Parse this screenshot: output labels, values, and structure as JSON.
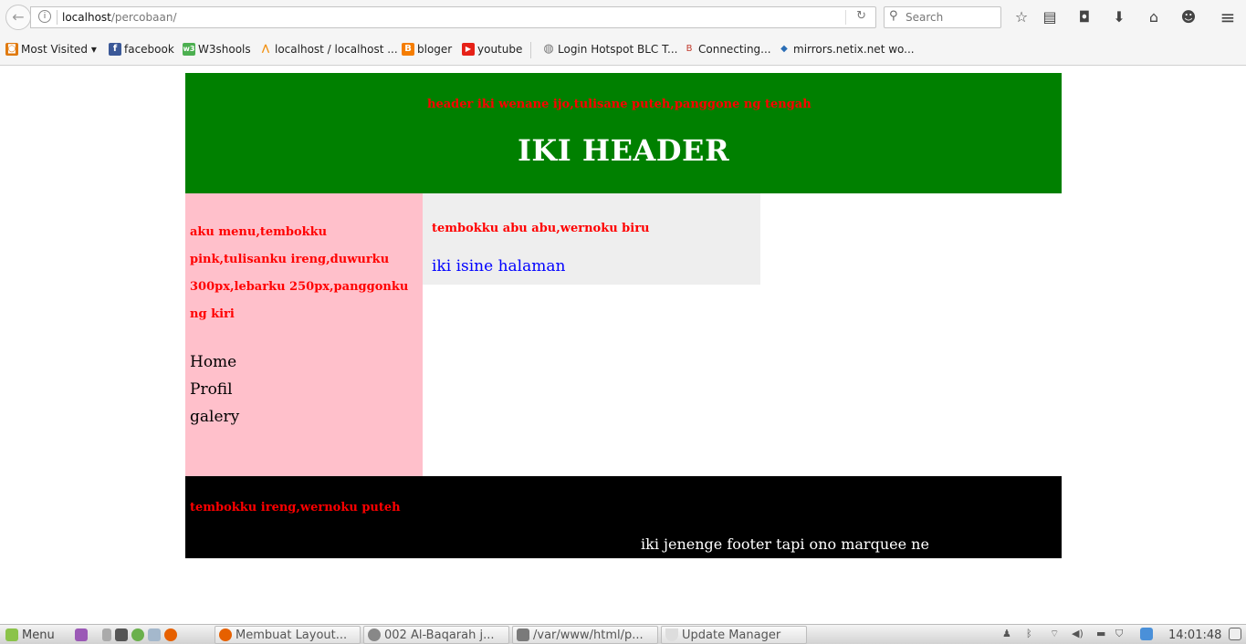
{
  "browser": {
    "url_host": "localhost",
    "url_path": "/percobaan/",
    "search_placeholder": "Search",
    "icons": [
      "back-arrow-icon",
      "info-icon",
      "reload-icon",
      "search-icon",
      "bookmark-star-icon",
      "reading-list-icon",
      "pocket-icon",
      "download-icon",
      "home-icon",
      "chat-icon",
      "hamburger-menu-icon"
    ],
    "glyphs": {
      "back": "←",
      "info": "i",
      "reload": "↻",
      "search": "⚲",
      "star": "☆",
      "reader": "▤",
      "pocket": "◘",
      "download": "⬇",
      "home": "⌂",
      "chat": "☻",
      "menu": "≡"
    }
  },
  "bookmarks": [
    {
      "label": "Most Visited ▾",
      "icon": "most-visited-icon",
      "color": "#e07a10",
      "glyph": "◙"
    },
    {
      "label": "facebook",
      "icon": "facebook-icon",
      "color": "#3b5998",
      "glyph": "f"
    },
    {
      "label": "W3shools",
      "icon": "w3schools-icon",
      "color": "#4caf50",
      "glyph": "w3"
    },
    {
      "label": "localhost / localhost ...",
      "icon": "phpmyadmin-icon",
      "color": "#f29111",
      "glyph": "⋀"
    },
    {
      "label": "bloger",
      "icon": "blogger-icon",
      "color": "#f57d00",
      "glyph": "B"
    },
    {
      "label": "youtube",
      "icon": "youtube-icon",
      "color": "#e62117",
      "glyph": "▶"
    },
    {
      "label": "Login Hotspot BLC T...",
      "icon": "globe-icon",
      "color": "#888888",
      "glyph": "◍"
    },
    {
      "label": "Connecting...",
      "icon": "bir-icon",
      "color": "#c0392b",
      "glyph": "B"
    },
    {
      "label": "mirrors.netix.net wo...",
      "icon": "tag-icon",
      "color": "#2a6db5",
      "glyph": "◆"
    }
  ],
  "page": {
    "header_note": "header iki wenane ijo,tulisane puteh,panggone ng tengah",
    "header_title": "IKI HEADER",
    "menu_note": "aku menu,tembokku pink,tulisanku ireng,duwurku 300px,lebarku 250px,panggonku ng kiri",
    "menu_links": [
      "Home",
      "Profil",
      "galery"
    ],
    "content_note": "tembokku abu abu,wernoku biru",
    "content_text": "iki isine halaman",
    "footer_note": "tembokku ireng,wernoku puteh",
    "footer_marquee": "iki jenenge footer tapi ono marquee ne",
    "colors": {
      "header_bg": "#008000",
      "menu_bg": "#ffc0cb",
      "content_bg": "#eeeeee",
      "footer_bg": "#000000",
      "note_color": "#ff0000",
      "content_text_color": "#0000ff"
    }
  },
  "taskbar": {
    "menu_label": "Menu",
    "tasks": [
      "Membuat Layout...",
      "002 Al-Baqarah j...",
      "/var/www/html/p...",
      "Update Manager"
    ],
    "clock": "14:01:48"
  }
}
